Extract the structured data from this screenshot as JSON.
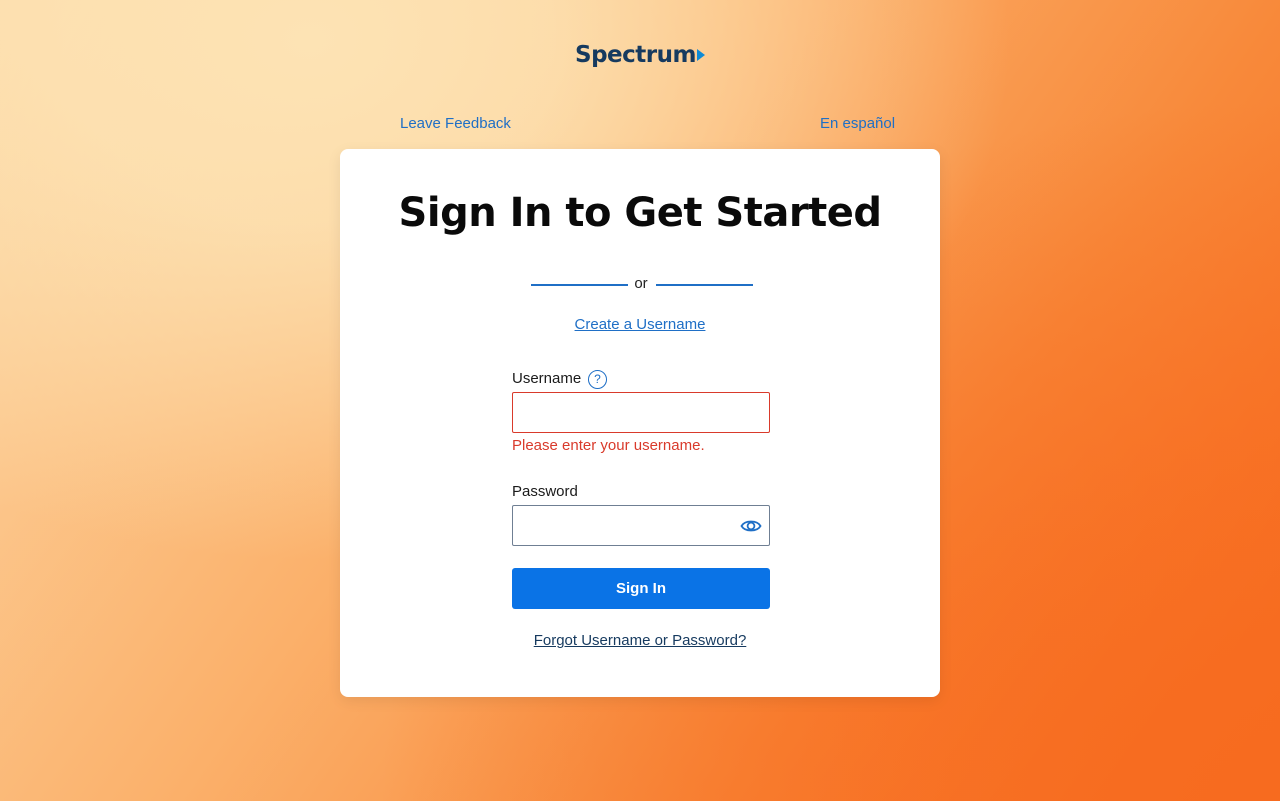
{
  "header": {
    "logo_text": "Spectrum",
    "logo_color": "#163a5f",
    "logo_arrow_color": "#0d8ad6",
    "feedback_link": "Leave Feedback",
    "language_link": "En español"
  },
  "card": {
    "title": "Sign In to Get Started",
    "divider_text": "or",
    "create_username_link": "Create a Username",
    "username": {
      "label": "Username",
      "value": "",
      "placeholder": "",
      "help_icon": "question-circle-icon",
      "error": "Please enter your username.",
      "error_color": "#d93a2b"
    },
    "password": {
      "label": "Password",
      "value": "",
      "placeholder": "",
      "toggle_icon": "eye-icon"
    },
    "signin_button": "Sign In",
    "forgot_link": "Forgot Username or Password?"
  },
  "colors": {
    "accent": "#0a73e6",
    "link": "#1f6fc6"
  }
}
